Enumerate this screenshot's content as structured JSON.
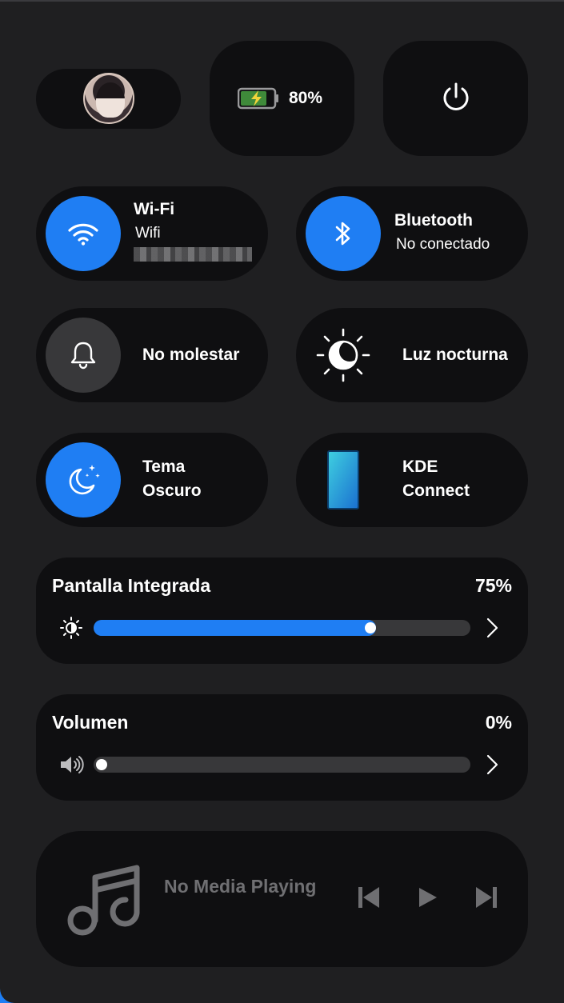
{
  "header": {
    "battery_percent": "80%",
    "battery_level": 0.8
  },
  "toggles": {
    "wifi": {
      "title": "Wi-Fi",
      "subtitle": "Wifi",
      "state": "on"
    },
    "bluetooth": {
      "title": "Bluetooth",
      "subtitle": "No conectado",
      "state": "on"
    },
    "dnd": {
      "title": "No molestar",
      "state": "off"
    },
    "night_light": {
      "title": "Luz nocturna",
      "state": "off"
    },
    "dark_theme": {
      "title_line1": "Tema",
      "title_line2": "Oscuro",
      "state": "on"
    },
    "kde_connect": {
      "title_line1": "KDE",
      "title_line2": "Connect"
    }
  },
  "brightness": {
    "label": "Pantalla Integrada",
    "value_text": "75%",
    "level": 0.75
  },
  "volume": {
    "label": "Volumen",
    "value_text": "0%",
    "level": 0.0
  },
  "media": {
    "status": "No Media Playing"
  },
  "colors": {
    "accent": "#1f7ef3",
    "card": "#0f0f11",
    "panel": "#1f1f21"
  },
  "icons": [
    "avatar",
    "battery-icon",
    "power-icon",
    "wifi-icon",
    "bluetooth-icon",
    "bell-icon",
    "night-light-icon",
    "dark-theme-icon",
    "phone-icon",
    "brightness-icon",
    "speaker-icon",
    "chevron-right-icon",
    "music-note-icon",
    "skip-previous-icon",
    "play-icon",
    "skip-next-icon"
  ]
}
